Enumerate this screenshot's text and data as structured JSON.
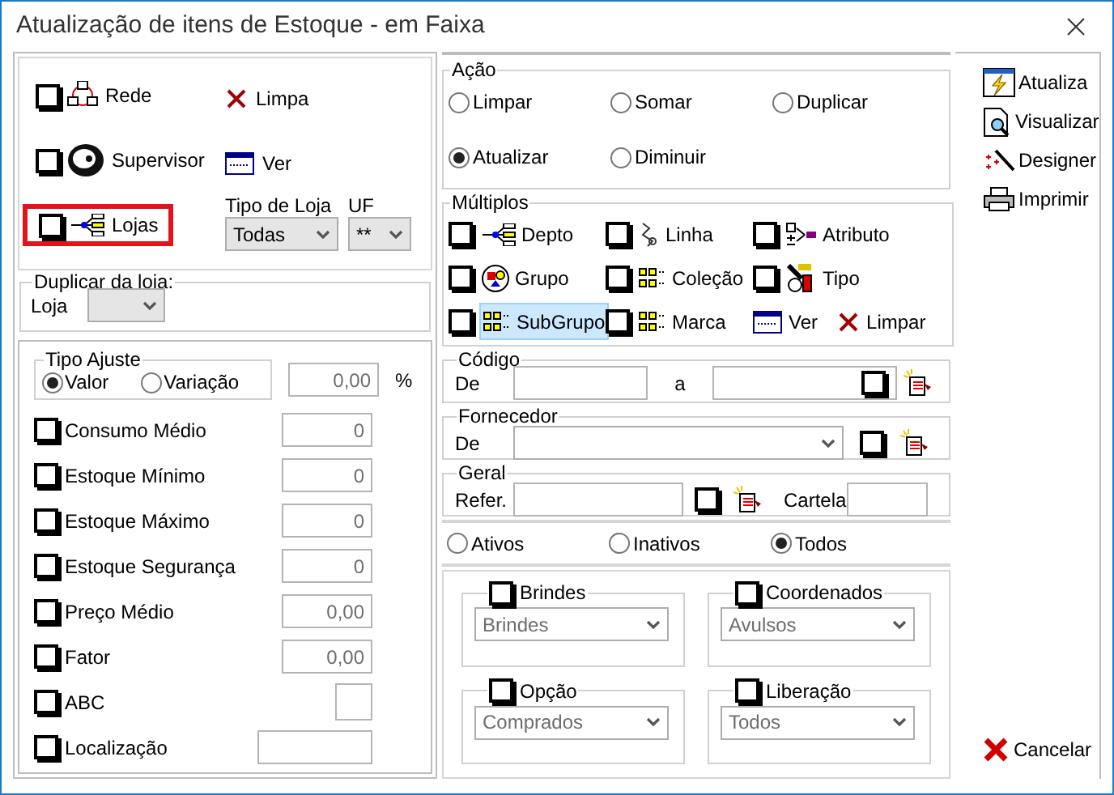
{
  "window": {
    "title": "Atualização de itens de Estoque - em Faixa"
  },
  "selection": {
    "checks": [
      {
        "label": "Rede",
        "checked": false,
        "highlighted": false
      },
      {
        "label": "Supervisor",
        "checked": false,
        "highlighted": false
      },
      {
        "label": "Lojas",
        "checked": false,
        "highlighted": true
      }
    ],
    "links": [
      "Limpa",
      "Ver"
    ],
    "tipo_loja": {
      "label": "Tipo de Loja",
      "value": "Todas"
    },
    "uf": {
      "label": "UF",
      "value": "**"
    }
  },
  "duplicar": {
    "title": "Duplicar da loja:",
    "label": "Loja"
  },
  "tipo_ajuste": {
    "title": "Tipo Ajuste",
    "options": [
      {
        "label": "Valor",
        "selected": true
      },
      {
        "label": "Variação",
        "selected": false
      }
    ],
    "value": "0,00",
    "unit": "%"
  },
  "fields": [
    {
      "label": "Consumo Médio",
      "checked": false,
      "kind": "number",
      "value": "0"
    },
    {
      "label": "Estoque Mínimo",
      "checked": false,
      "kind": "number",
      "value": "0"
    },
    {
      "label": "Estoque Máximo",
      "checked": false,
      "kind": "number",
      "value": "0"
    },
    {
      "label": "Estoque Segurança",
      "checked": false,
      "kind": "number",
      "value": "0"
    },
    {
      "label": "Preço Médio",
      "checked": false,
      "kind": "number",
      "value": "0,00"
    },
    {
      "label": "Fator",
      "checked": false,
      "kind": "number",
      "value": "0,00"
    },
    {
      "label": "ABC",
      "checked": false,
      "kind": "code"
    },
    {
      "label": "Localização",
      "checked": false,
      "kind": "text"
    }
  ],
  "acao": {
    "title": "Ação",
    "options": [
      {
        "label": "Limpar",
        "selected": false
      },
      {
        "label": "Somar",
        "selected": false
      },
      {
        "label": "Duplicar",
        "selected": false
      },
      {
        "label": "Atualizar",
        "selected": true
      },
      {
        "label": "Diminuir",
        "selected": false
      }
    ]
  },
  "multiplos": {
    "title": "Múltiplos",
    "items": [
      {
        "label": "Depto",
        "checked": false,
        "focused": false
      },
      {
        "label": "Linha",
        "checked": false,
        "focused": false
      },
      {
        "label": "Atributo",
        "checked": false,
        "focused": false
      },
      {
        "label": "Grupo",
        "checked": false,
        "focused": false
      },
      {
        "label": "Coleção",
        "checked": false,
        "focused": false
      },
      {
        "label": "Tipo",
        "checked": false,
        "focused": false
      },
      {
        "label": "SubGrupo",
        "checked": false,
        "focused": true
      },
      {
        "label": "Marca",
        "checked": false,
        "focused": false
      }
    ],
    "links": [
      "Ver",
      "Limpar"
    ]
  },
  "codigo": {
    "title": "Código",
    "from_label": "De",
    "to_label": "a",
    "checked": false
  },
  "fornecedor": {
    "title": "Fornecedor",
    "label": "De",
    "checked": false
  },
  "geral": {
    "title": "Geral",
    "refer_label": "Refer.",
    "checked": false,
    "cartela_label": "Cartela"
  },
  "status": {
    "options": [
      {
        "label": "Ativos",
        "selected": false
      },
      {
        "label": "Inativos",
        "selected": false
      },
      {
        "label": "Todos",
        "selected": true
      }
    ]
  },
  "groups": [
    {
      "label": "Brindes",
      "checked": false,
      "value": "Brindes"
    },
    {
      "label": "Coordenados",
      "checked": false,
      "value": "Avulsos"
    },
    {
      "label": "Opção",
      "checked": false,
      "value": "Comprados"
    },
    {
      "label": "Liberação",
      "checked": false,
      "value": "Todos"
    }
  ],
  "buttons": [
    "Atualiza",
    "Visualizar",
    "Designer",
    "Imprimir"
  ],
  "cancel": "Cancelar"
}
